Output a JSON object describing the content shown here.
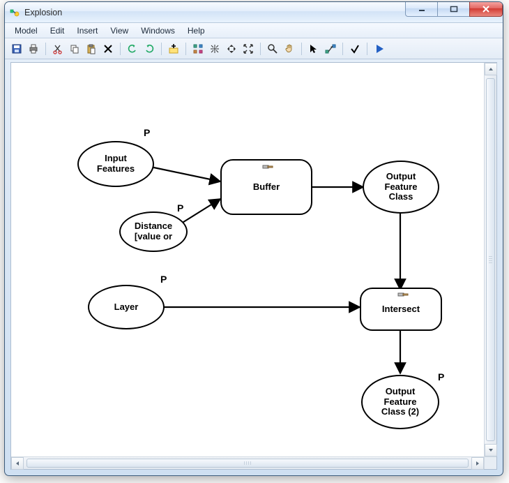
{
  "window": {
    "title": "Explosion"
  },
  "menu": {
    "items": [
      "Model",
      "Edit",
      "Insert",
      "View",
      "Windows",
      "Help"
    ]
  },
  "toolbar": {
    "buttons": [
      "save-icon",
      "print-icon",
      "sep",
      "cut-icon",
      "copy-icon",
      "paste-icon",
      "delete-icon",
      "sep",
      "undo-icon",
      "redo-icon",
      "sep",
      "add-data-icon",
      "sep",
      "auto-layout-icon",
      "zoom-full-icon",
      "zoom-in-icon",
      "fit-window-icon",
      "sep",
      "zoom-tool-icon",
      "pan-icon",
      "sep",
      "select-icon",
      "connect-icon",
      "sep",
      "validate-icon",
      "sep",
      "run-icon"
    ]
  },
  "model": {
    "p_label": "P",
    "nodes": {
      "input_features": {
        "label": "Input\nFeatures"
      },
      "distance": {
        "label": "Distance\n[value or"
      },
      "buffer": {
        "label": "Buffer"
      },
      "output_fc": {
        "label": "Output\nFeature\nClass"
      },
      "layer": {
        "label": "Layer"
      },
      "intersect": {
        "label": "Intersect"
      },
      "output_fc2": {
        "label": "Output\nFeature\nClass (2)"
      }
    }
  }
}
